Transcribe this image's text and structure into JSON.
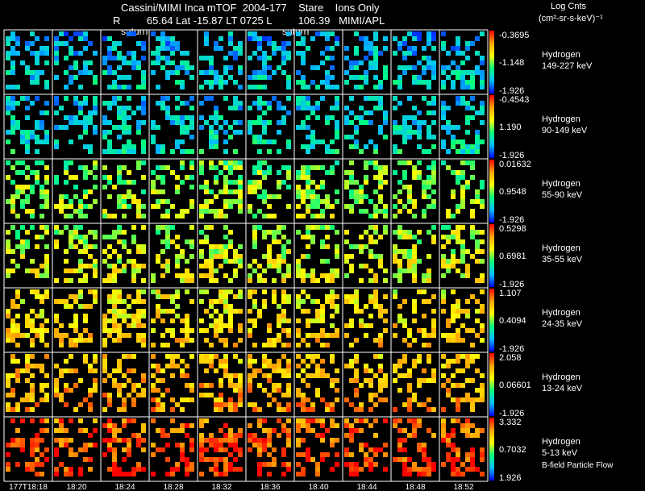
{
  "header": {
    "title": "Cassini/MIMI Inca mTOF  2004-177    Stare    Ions Only",
    "subtitle": "R         65.64 Lat -15.87 LT 0725 L         106.39   MIMI/APL",
    "planet_label_1": "saturn",
    "planet_label_2": "saturn",
    "units_line1": "Log Cnts",
    "units_line2": "(cm²-sr-s-keV)⁻¹"
  },
  "footer_note": "B-field Particle Flow",
  "colors": {
    "background": "#000000",
    "grid": "#ffffff",
    "colorbar": [
      "#ff0000",
      "#ffa500",
      "#ffff00",
      "#00ff7f",
      "#00bfff",
      "#0000ff"
    ]
  },
  "chart_data": {
    "type": "heatmap",
    "time_labels": [
      "177T18:18",
      "18:20",
      "18:24",
      "18:28",
      "18:32",
      "18:36",
      "18:40",
      "18:44",
      "18:48",
      "18:52"
    ],
    "rows": [
      {
        "species": "Hydrogen",
        "energy": "149-227 keV",
        "cmax": "-0.3695",
        "cmid": "-1.148",
        "cmin": "-1.926",
        "level": 0.18
      },
      {
        "species": "Hydrogen",
        "energy": "90-149 keV",
        "cmax": "-0.4543",
        "cmid": "1.190",
        "cmin": "-1.926",
        "level": 0.22
      },
      {
        "species": "Hydrogen",
        "energy": "55-90 keV",
        "cmax": "0.01632",
        "cmid": "0.9548",
        "cmin": "-1.926",
        "level": 0.45
      },
      {
        "species": "Hydrogen",
        "energy": "35-55 keV",
        "cmax": "0.5298",
        "cmid": "0.6981",
        "cmin": "-1.926",
        "level": 0.52
      },
      {
        "species": "Hydrogen",
        "energy": "24-35 keV",
        "cmax": "1.107",
        "cmid": "0.4094",
        "cmin": "-1.926",
        "level": 0.62
      },
      {
        "species": "Hydrogen",
        "energy": "13-24 keV",
        "cmax": "2.058",
        "cmid": "0.06601",
        "cmin": "-1.926",
        "level": 0.7
      },
      {
        "species": "Hydrogen",
        "energy": "5-13 keV",
        "cmax": "3.332",
        "cmid": "0.7032",
        "cmin": "1.926",
        "level": 0.85
      }
    ]
  }
}
